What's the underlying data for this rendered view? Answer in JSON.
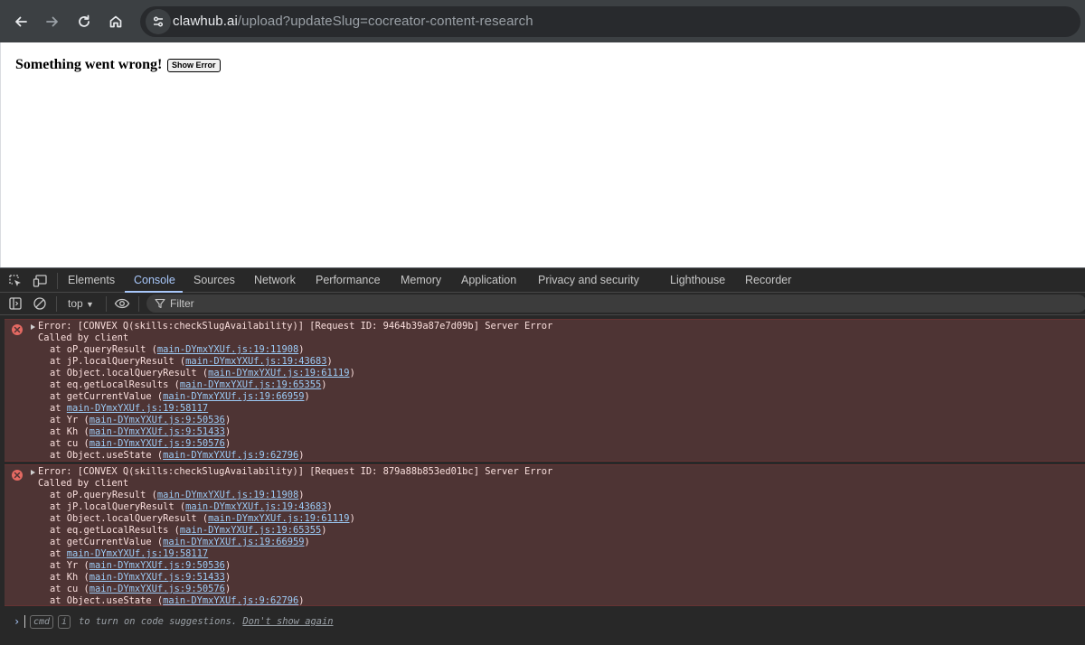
{
  "browser": {
    "url_host": "clawhub.ai",
    "url_rest": "/upload?updateSlug=cocreator-content-research",
    "back_icon": "arrow-left-icon",
    "forward_icon": "arrow-right-icon",
    "reload_icon": "reload-icon",
    "home_icon": "home-icon",
    "site_info_icon": "tune-icon"
  },
  "page": {
    "error_title": "Something went wrong!",
    "show_error_label": "Show Error"
  },
  "devtools": {
    "tabs": [
      "Elements",
      "Console",
      "Sources",
      "Network",
      "Performance",
      "Memory",
      "Application",
      "Privacy and security",
      "Lighthouse",
      "Recorder"
    ],
    "active_tab": "Console",
    "context": "top",
    "filter_placeholder": "Filter",
    "messages": [
      {
        "header": "Error: [CONVEX Q(skills:checkSlugAvailability)] [Request ID: 9464b39a87e7d09b] Server Error",
        "called_by": "Called by client",
        "frames": [
          {
            "prefix": "at oP.queryResult (",
            "link": "main-DYmxYXUf.js:19:11908",
            "suffix": ")"
          },
          {
            "prefix": "at jP.localQueryResult (",
            "link": "main-DYmxYXUf.js:19:43683",
            "suffix": ")"
          },
          {
            "prefix": "at Object.localQueryResult (",
            "link": "main-DYmxYXUf.js:19:61119",
            "suffix": ")"
          },
          {
            "prefix": "at eq.getLocalResults (",
            "link": "main-DYmxYXUf.js:19:65355",
            "suffix": ")"
          },
          {
            "prefix": "at getCurrentValue (",
            "link": "main-DYmxYXUf.js:19:66959",
            "suffix": ")"
          },
          {
            "prefix": "at ",
            "link": "main-DYmxYXUf.js:19:58117",
            "suffix": ""
          },
          {
            "prefix": "at Yr (",
            "link": "main-DYmxYXUf.js:9:50536",
            "suffix": ")"
          },
          {
            "prefix": "at Kh (",
            "link": "main-DYmxYXUf.js:9:51433",
            "suffix": ")"
          },
          {
            "prefix": "at cu (",
            "link": "main-DYmxYXUf.js:9:50576",
            "suffix": ")"
          },
          {
            "prefix": "at Object.useState (",
            "link": "main-DYmxYXUf.js:9:62796",
            "suffix": ")"
          }
        ]
      },
      {
        "header": "Error: [CONVEX Q(skills:checkSlugAvailability)] [Request ID: 879a88b853ed01bc] Server Error",
        "called_by": "Called by client",
        "frames": [
          {
            "prefix": "at oP.queryResult (",
            "link": "main-DYmxYXUf.js:19:11908",
            "suffix": ")"
          },
          {
            "prefix": "at jP.localQueryResult (",
            "link": "main-DYmxYXUf.js:19:43683",
            "suffix": ")"
          },
          {
            "prefix": "at Object.localQueryResult (",
            "link": "main-DYmxYXUf.js:19:61119",
            "suffix": ")"
          },
          {
            "prefix": "at eq.getLocalResults (",
            "link": "main-DYmxYXUf.js:19:65355",
            "suffix": ")"
          },
          {
            "prefix": "at getCurrentValue (",
            "link": "main-DYmxYXUf.js:19:66959",
            "suffix": ")"
          },
          {
            "prefix": "at ",
            "link": "main-DYmxYXUf.js:19:58117",
            "suffix": ""
          },
          {
            "prefix": "at Yr (",
            "link": "main-DYmxYXUf.js:9:50536",
            "suffix": ")"
          },
          {
            "prefix": "at Kh (",
            "link": "main-DYmxYXUf.js:9:51433",
            "suffix": ")"
          },
          {
            "prefix": "at cu (",
            "link": "main-DYmxYXUf.js:9:50576",
            "suffix": ")"
          },
          {
            "prefix": "at Object.useState (",
            "link": "main-DYmxYXUf.js:9:62796",
            "suffix": ")"
          }
        ]
      }
    ],
    "prompt": {
      "key1": "cmd",
      "key2": "i",
      "hint": " to turn on code suggestions. ",
      "dont_show": "Don't show again"
    }
  },
  "colors": {
    "error_bg": "#4e3434",
    "error_text": "#f9dedc",
    "link": "#9ccbf6",
    "accent": "#a8c7fa"
  }
}
